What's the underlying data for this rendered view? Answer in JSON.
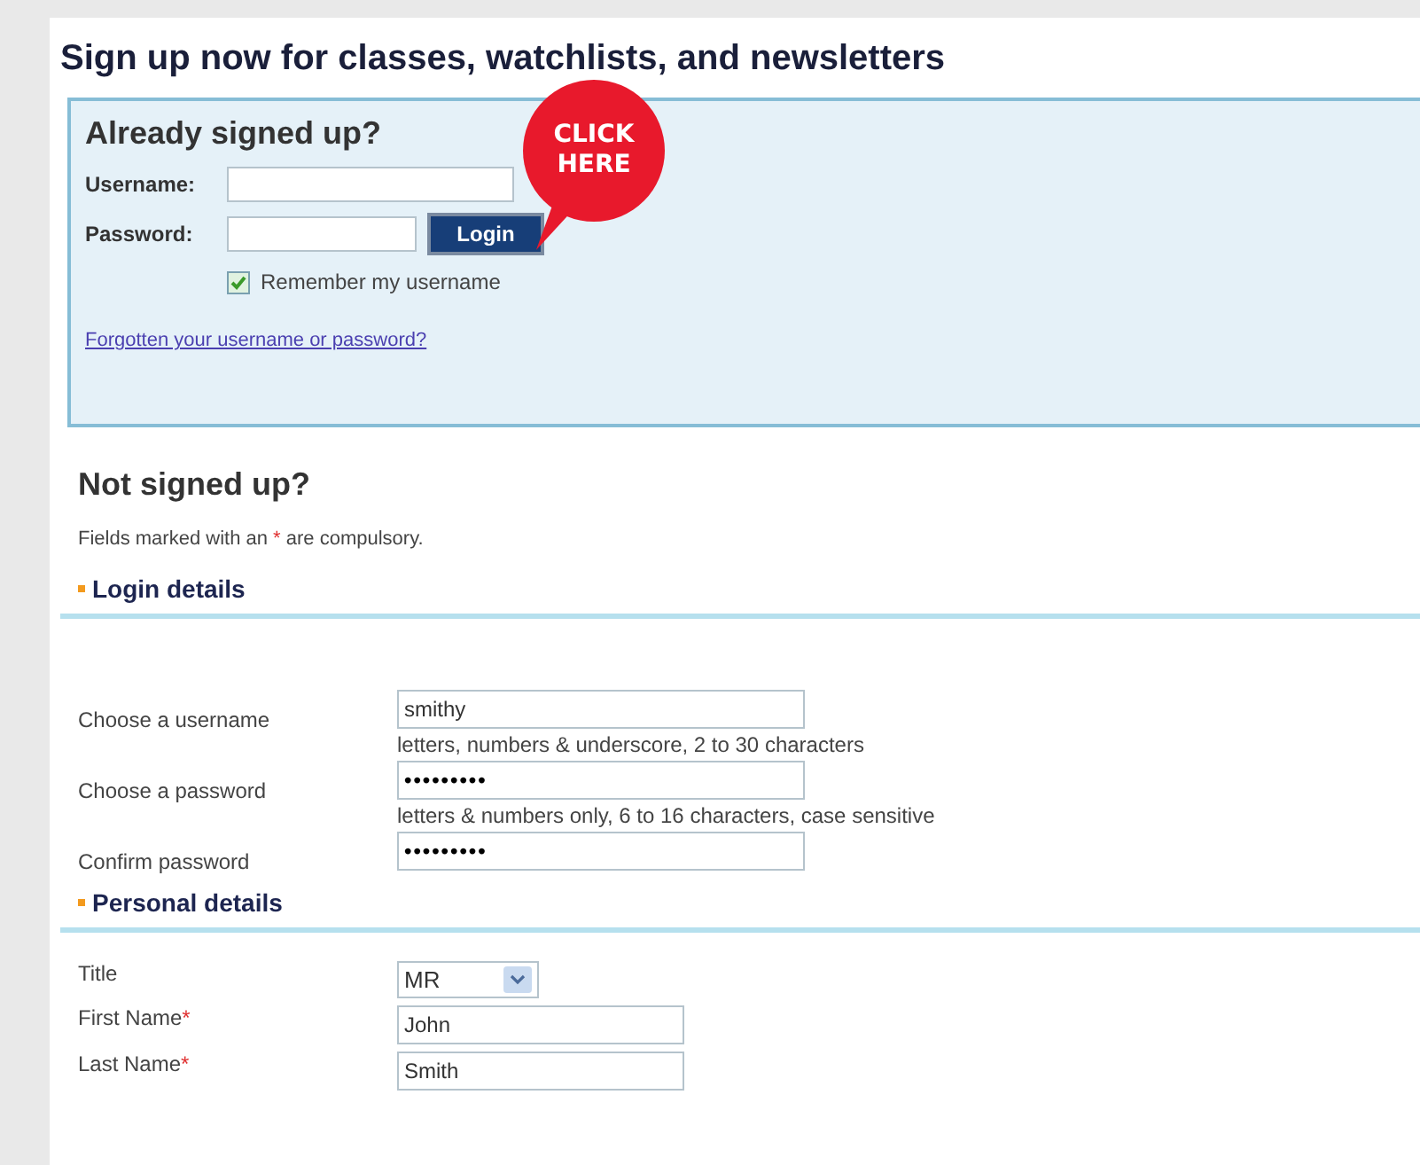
{
  "page_title": "Sign up now for classes, watchlists, and newsletters",
  "login": {
    "heading": "Already signed up?",
    "username_label": "Username:",
    "password_label": "Password:",
    "button": "Login",
    "remember": {
      "label": "Remember my username",
      "checked": true
    },
    "forgot_link": "Forgotten your username or password?"
  },
  "callout": {
    "lines": [
      "CLICK",
      "HERE"
    ]
  },
  "signup": {
    "heading": "Not signed up?",
    "note": {
      "before": "Fields marked with an",
      "mark": "*",
      "after": "are compulsory."
    },
    "sections": [
      {
        "title": "Login details",
        "fields": [
          {
            "kind": "text",
            "label": "Choose a username",
            "value": "smithy",
            "hint": "letters, numbers & underscore, 2 to 30 characters"
          },
          {
            "kind": "password",
            "label": "Choose a password",
            "value": "•••••••••",
            "hint": "letters & numbers only, 6 to 16 characters, case sensitive"
          },
          {
            "kind": "password",
            "label": "Confirm password",
            "value": "•••••••••"
          }
        ]
      },
      {
        "title": "Personal details",
        "fields": [
          {
            "kind": "select",
            "label": "Title",
            "value": "MR"
          },
          {
            "kind": "text",
            "label": "First Name",
            "required_mark": "*",
            "value": "John"
          },
          {
            "kind": "text",
            "label": "Last Name",
            "required_mark": "*",
            "value": "Smith"
          }
        ]
      }
    ]
  }
}
